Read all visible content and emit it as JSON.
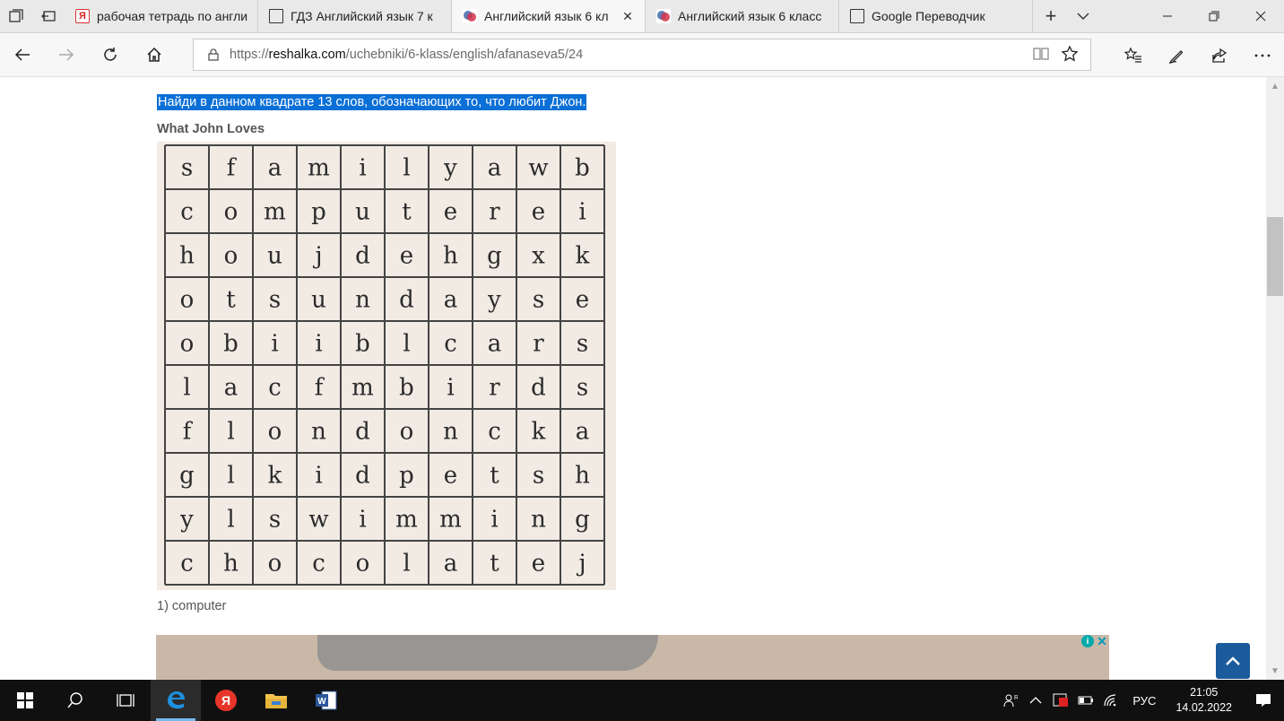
{
  "tabs": [
    {
      "label": "рабочая тетрадь по англи",
      "icon": "yandex-icon",
      "active": false
    },
    {
      "label": "ГДЗ Английский язык 7 к",
      "icon": "page-icon",
      "active": false
    },
    {
      "label": "Английский язык 6 кл",
      "icon": "reshalka-icon",
      "active": true
    },
    {
      "label": "Английский язык 6 класс",
      "icon": "reshalka-icon",
      "active": false
    },
    {
      "label": "Google Переводчик",
      "icon": "page-icon",
      "active": false
    }
  ],
  "address": {
    "prefix": "https://",
    "host": "reshalka.com",
    "path": "/uchebniki/6-klass/english/afanaseva5/24"
  },
  "content": {
    "task": "Найди в данном квадрате 13 слов, обозначающих то, что любит Джон.",
    "subheading": "What John Loves",
    "answer": "1) computer"
  },
  "puzzle_grid": [
    [
      "s",
      "f",
      "a",
      "m",
      "i",
      "l",
      "y",
      "a",
      "w",
      "b"
    ],
    [
      "c",
      "o",
      "m",
      "p",
      "u",
      "t",
      "e",
      "r",
      "e",
      "i"
    ],
    [
      "h",
      "o",
      "u",
      "j",
      "d",
      "e",
      "h",
      "g",
      "x",
      "k"
    ],
    [
      "o",
      "t",
      "s",
      "u",
      "n",
      "d",
      "a",
      "y",
      "s",
      "e"
    ],
    [
      "o",
      "b",
      "i",
      "i",
      "b",
      "l",
      "c",
      "a",
      "r",
      "s"
    ],
    [
      "l",
      "a",
      "c",
      "f",
      "m",
      "b",
      "i",
      "r",
      "d",
      "s"
    ],
    [
      "f",
      "l",
      "o",
      "n",
      "d",
      "o",
      "n",
      "c",
      "k",
      "a"
    ],
    [
      "g",
      "l",
      "k",
      "i",
      "d",
      "p",
      "e",
      "t",
      "s",
      "h"
    ],
    [
      "y",
      "l",
      "s",
      "w",
      "i",
      "m",
      "m",
      "i",
      "n",
      "g"
    ],
    [
      "c",
      "h",
      "o",
      "c",
      "o",
      "l",
      "a",
      "t",
      "e",
      "j"
    ]
  ],
  "taskbar": {
    "lang": "РУС",
    "time": "21:05",
    "date": "14.02.2022"
  },
  "colors": {
    "selection": "#0a6fd6",
    "taskbar": "#101010",
    "scroll_top_button": "#1b5b9c"
  }
}
